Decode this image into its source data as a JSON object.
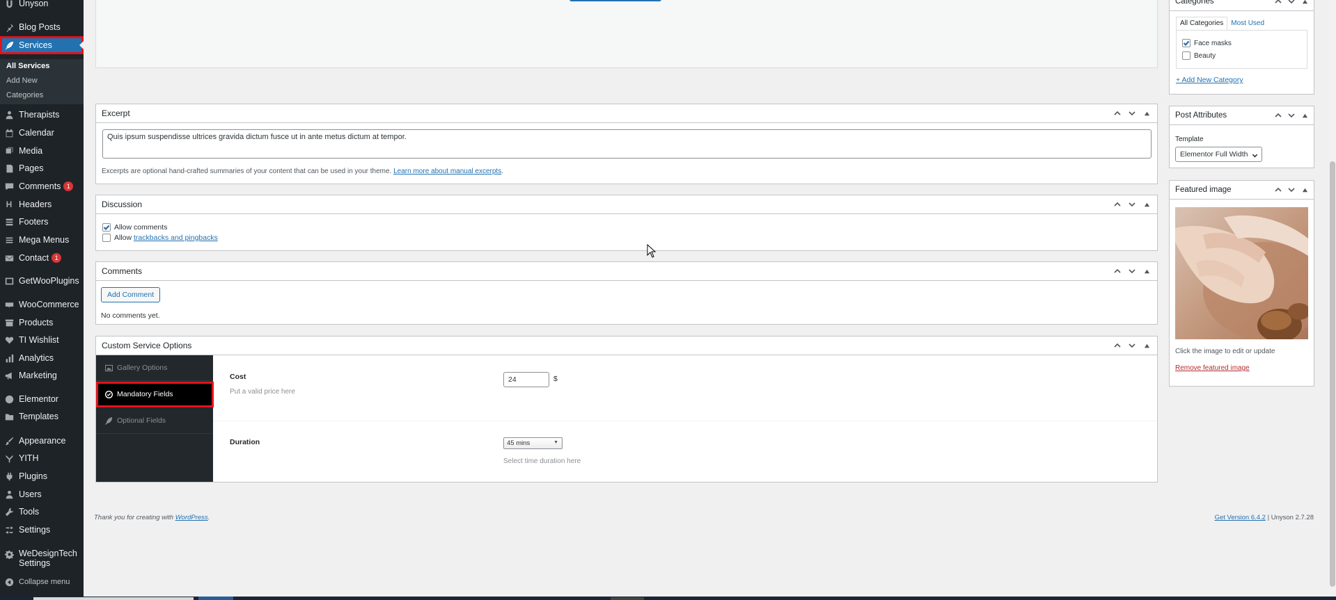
{
  "sidebar": {
    "items": [
      {
        "label": "Unyson",
        "icon": "unyson-icon"
      },
      {
        "label": "Blog Posts",
        "icon": "pin-icon"
      },
      {
        "label": "Services",
        "icon": "feather-icon"
      },
      {
        "label": "Therapists",
        "icon": "person-icon"
      },
      {
        "label": "Calendar",
        "icon": "calendar-icon"
      },
      {
        "label": "Media",
        "icon": "media-icon"
      },
      {
        "label": "Pages",
        "icon": "pages-icon"
      },
      {
        "label": "Comments",
        "icon": "comment-icon",
        "badge": "1"
      },
      {
        "label": "Headers",
        "icon": "header-icon"
      },
      {
        "label": "Footers",
        "icon": "footer-icon"
      },
      {
        "label": "Mega Menus",
        "icon": "menu-icon"
      },
      {
        "label": "Contact",
        "icon": "mail-icon",
        "badge": "1"
      },
      {
        "label": "GetWooPlugins",
        "icon": "plugin-grid-icon"
      },
      {
        "label": "WooCommerce",
        "icon": "woo-icon"
      },
      {
        "label": "Products",
        "icon": "archive-icon"
      },
      {
        "label": "TI Wishlist",
        "icon": "heart-icon"
      },
      {
        "label": "Analytics",
        "icon": "chart-icon"
      },
      {
        "label": "Marketing",
        "icon": "megaphone-icon"
      },
      {
        "label": "Elementor",
        "icon": "elementor-icon"
      },
      {
        "label": "Templates",
        "icon": "folder-icon"
      },
      {
        "label": "Appearance",
        "icon": "brush-icon"
      },
      {
        "label": "YITH",
        "icon": "yith-icon"
      },
      {
        "label": "Plugins",
        "icon": "plug-icon"
      },
      {
        "label": "Users",
        "icon": "users-icon"
      },
      {
        "label": "Tools",
        "icon": "wrench-icon"
      },
      {
        "label": "Settings",
        "icon": "settings-icon"
      },
      {
        "label": "WeDesignTech Settings",
        "line1": "WeDesignTech",
        "line2": "Settings",
        "icon": "gear-icon"
      },
      {
        "label": "Collapse menu",
        "icon": "collapse-icon"
      }
    ],
    "services_submenu": [
      "All Services",
      "Add New",
      "Categories"
    ]
  },
  "excerpt": {
    "title": "Excerpt",
    "value": "Quis ipsum suspendisse ultrices gravida dictum fusce ut in ante metus dictum at tempor.",
    "help": "Excerpts are optional hand-crafted summaries of your content that can be used in your theme.",
    "help_link": "Learn more about manual excerpts",
    "help_end": "."
  },
  "discussion": {
    "title": "Discussion",
    "allow_comments": "Allow comments",
    "allow_prefix": "Allow",
    "trackbacks_link": "trackbacks and pingbacks"
  },
  "comments": {
    "title": "Comments",
    "add_button": "Add Comment",
    "empty": "No comments yet."
  },
  "custom_service_options": {
    "title": "Custom Service Options",
    "tabs": [
      "Gallery Options",
      "Mandatory Fields",
      "Optional Fields"
    ],
    "cost_label": "Cost",
    "cost_help": "Put a valid price here",
    "cost_value": "24",
    "cost_unit": "$",
    "duration_label": "Duration",
    "duration_value": "45 mins",
    "duration_help": "Select time duration here"
  },
  "categories": {
    "title": "Categories",
    "tab_all": "All Categories",
    "tab_most_used": "Most Used",
    "items": [
      {
        "label": "Face masks",
        "checked": true
      },
      {
        "label": "Beauty",
        "checked": false
      }
    ],
    "add_new": "+ Add New Category"
  },
  "post_attributes": {
    "title": "Post Attributes",
    "template_label": "Template",
    "template_value": "Elementor Full Width"
  },
  "featured_image": {
    "title": "Featured image",
    "help": "Click the image to edit or update",
    "remove": "Remove featured image"
  },
  "footer": {
    "thanks_prefix": "Thank you for creating with",
    "thanks_link": "WordPress",
    "thanks_end": ".",
    "version_link": "Get Version 6.4.2",
    "version_sep": "|",
    "unyson_version": "Unyson 2.7.28"
  },
  "colors": {
    "admin_bar": "#1d2327",
    "accent": "#2271b1",
    "highlight_outline": "#e2131b",
    "badge": "#d63638"
  }
}
